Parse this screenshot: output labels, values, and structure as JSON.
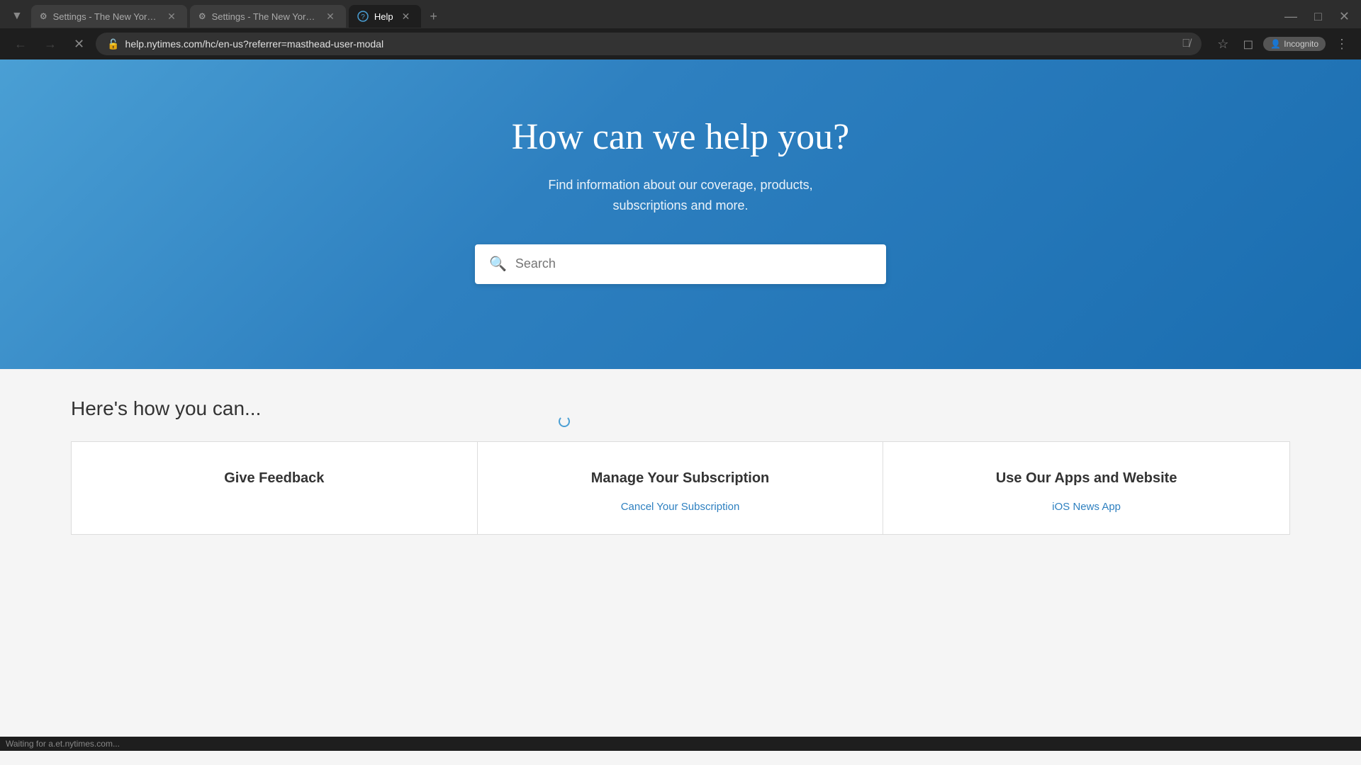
{
  "browser": {
    "tabs": [
      {
        "id": "tab1",
        "title": "Settings - The New York Times",
        "favicon": "⚙",
        "active": false
      },
      {
        "id": "tab2",
        "title": "Settings - The New York Times",
        "favicon": "⚙",
        "active": false
      },
      {
        "id": "tab3",
        "title": "Help",
        "favicon": "?",
        "active": true
      }
    ],
    "address": "help.nytimes.com/hc/en-us?referrer=masthead-user-modal",
    "status": "Waiting for a.et.nytimes.com...",
    "incognito_label": "Incognito"
  },
  "hero": {
    "title": "How can we help you?",
    "subtitle_line1": "Find information about our coverage, products,",
    "subtitle_line2": "subscriptions and more.",
    "search_placeholder": "Search"
  },
  "below_fold": {
    "section_title": "Here's how you can...",
    "cards": [
      {
        "title": "Give Feedback",
        "links": []
      },
      {
        "title": "Manage Your Subscription",
        "links": [
          {
            "text": "Cancel Your Subscription"
          }
        ]
      },
      {
        "title": "Use Our Apps and Website",
        "links": [
          {
            "text": "iOS News App"
          }
        ]
      }
    ]
  }
}
